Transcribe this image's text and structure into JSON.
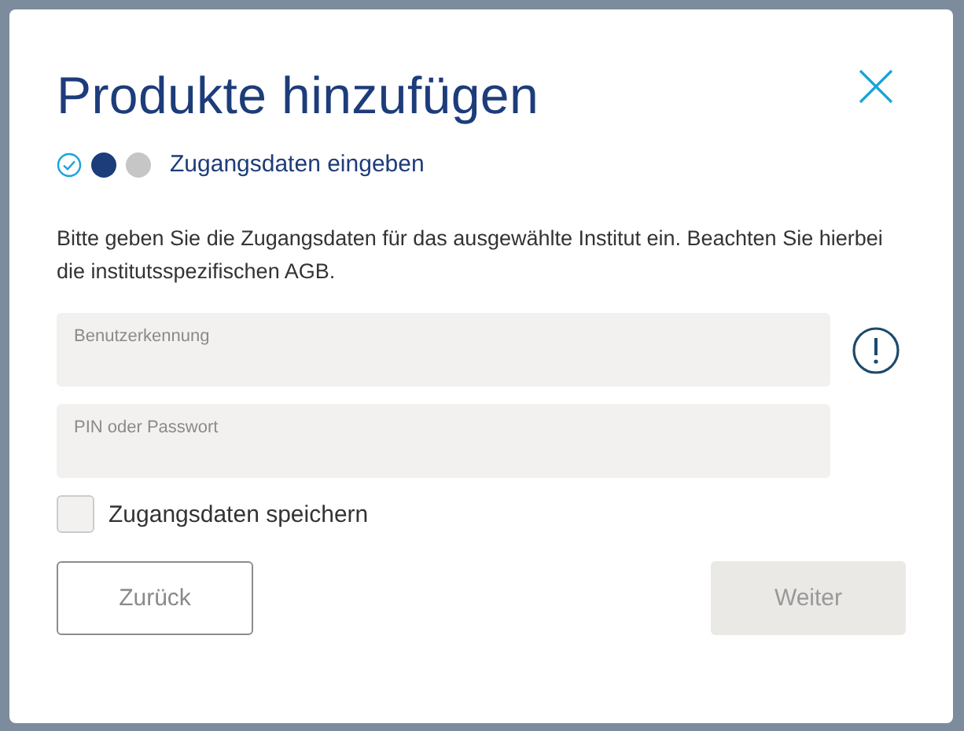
{
  "dialog": {
    "title": "Produkte hinzufügen",
    "steps": [
      {
        "kind": "check"
      },
      {
        "kind": "dot",
        "selected": true
      },
      {
        "kind": "dot",
        "selected": false
      }
    ],
    "step_label": "Zugangsdaten eingeben",
    "description": "Bitte geben Sie die Zugangsdaten für das ausgewählte Institut ein. Beachten Sie hierbei die institutsspezifischen AGB.",
    "fields": [
      {
        "placeholder": "Benutzerkennung",
        "info": true
      },
      {
        "placeholder": "PIN oder Passwort",
        "info": false
      }
    ],
    "save_checkbox": {
      "label": "Zugangsdaten speichern",
      "checked": false
    },
    "back_button": {
      "label": "Zurück",
      "disabled": false
    },
    "next_button": {
      "label": "Weiter",
      "disabled": true
    }
  }
}
